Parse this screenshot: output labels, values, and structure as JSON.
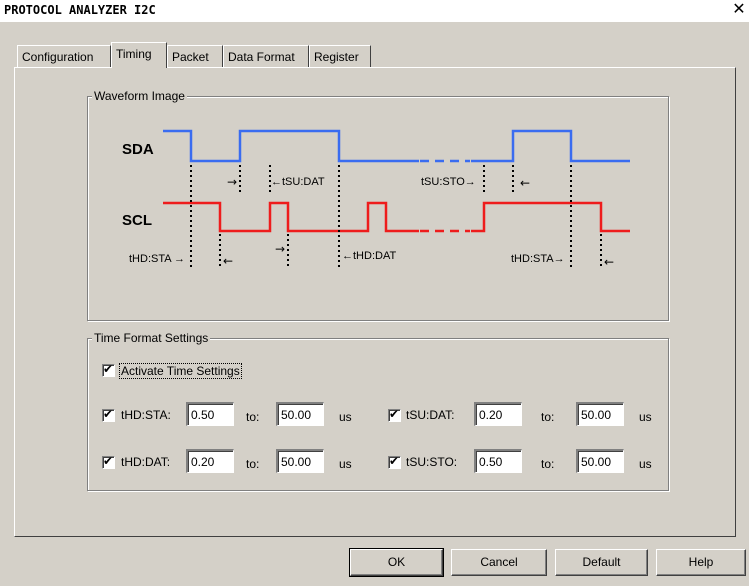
{
  "window": {
    "title": "PROTOCOL ANALYZER I2C",
    "close_glyph": "✕"
  },
  "tabs": [
    {
      "label": "Configuration",
      "active": false
    },
    {
      "label": "Timing",
      "active": true
    },
    {
      "label": "Packet",
      "active": false
    },
    {
      "label": "Data Format",
      "active": false
    },
    {
      "label": "Register",
      "active": false
    }
  ],
  "waveform": {
    "group_label": "Waveform Image",
    "sda_label": "SDA",
    "scl_label": "SCL",
    "sda_color": "#3a6cf0",
    "scl_color": "#ee1c1c",
    "labels": {
      "t_su_dat": "←tSU:DAT",
      "t_su_sto": "tSU:STO→",
      "t_hd_sta_1": "tHD:STA →",
      "t_hd_dat": "←tHD:DAT",
      "t_hd_sta_2": "tHD:STA→"
    }
  },
  "time_format": {
    "group_label": "Time Format Settings",
    "activate_label": "Activate Time Settings",
    "to_label": "to:",
    "unit": "us",
    "params": [
      {
        "name": "tHD:STA:",
        "from": "0.50",
        "to": "50.00"
      },
      {
        "name": "tSU:DAT:",
        "from": "0.20",
        "to": "50.00"
      },
      {
        "name": "tHD:DAT:",
        "from": "0.20",
        "to": "50.00"
      },
      {
        "name": "tSU:STO:",
        "from": "0.50",
        "to": "50.00"
      }
    ]
  },
  "buttons": {
    "ok": "OK",
    "cancel": "Cancel",
    "default": "Default",
    "help": "Help"
  }
}
